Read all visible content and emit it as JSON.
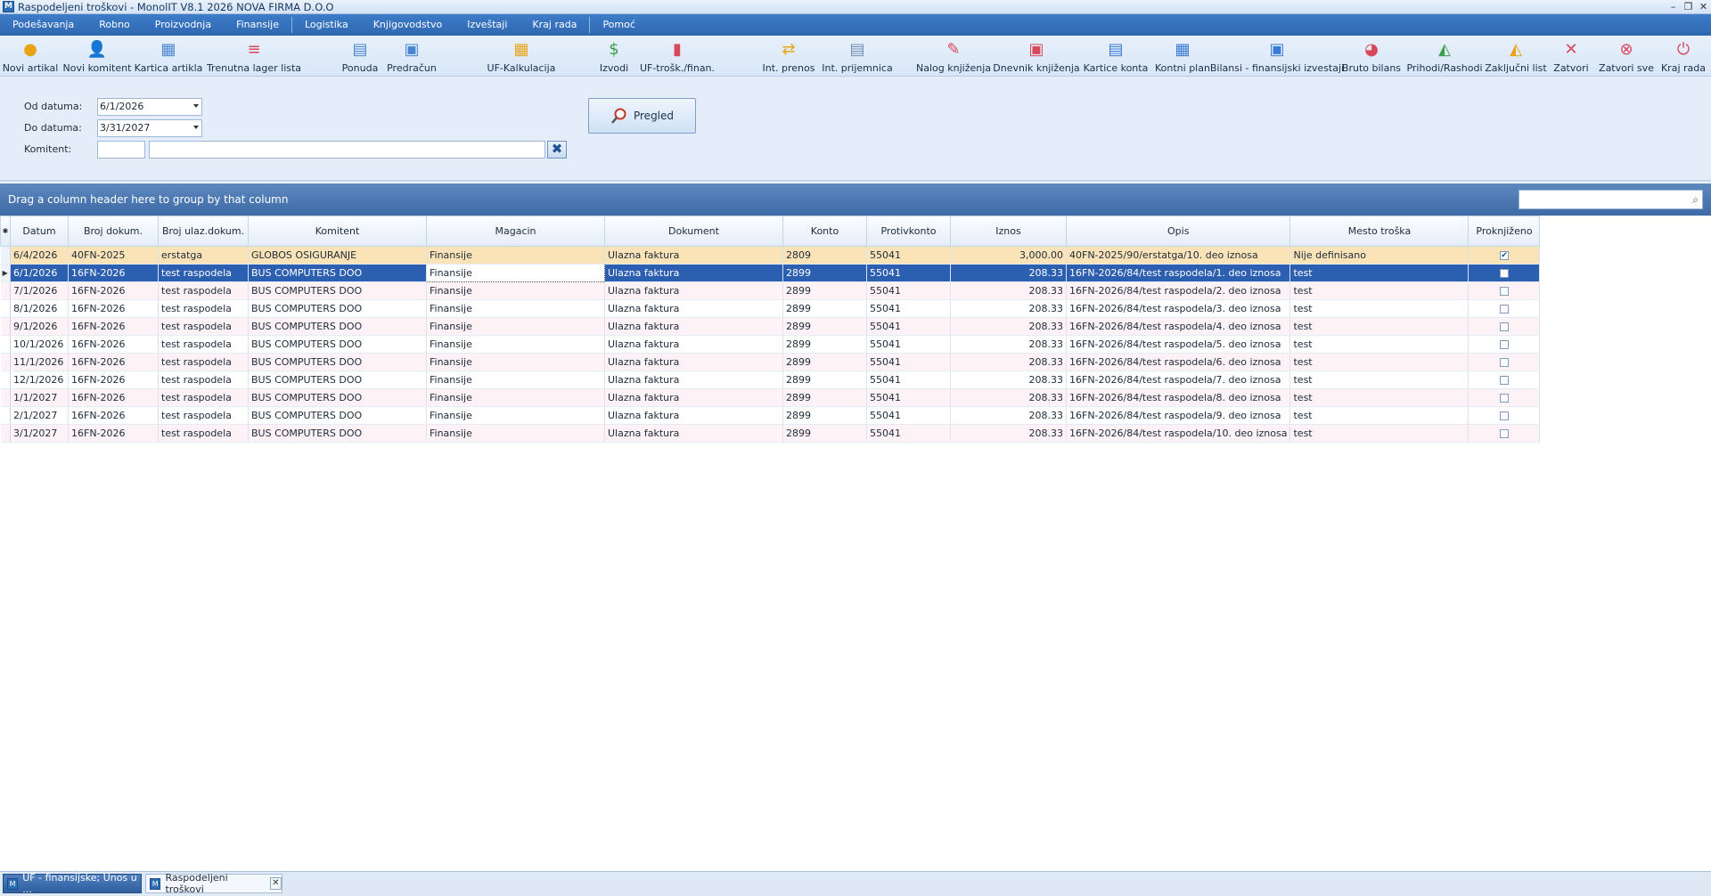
{
  "window": {
    "title": "Raspodeljeni troškovi - MonolIT V8.1 2026 NOVA FIRMA D.O.O",
    "app_icon": "M",
    "minimize": "–",
    "restore": "❐",
    "close": "✕"
  },
  "menu": [
    "Podešavanja",
    "Robno",
    "Proizvodnja",
    "Finansije",
    "Logistika",
    "Knjigovodstvo",
    "Izveštaji",
    "Kraj rada",
    "Pomoć"
  ],
  "toolbar": [
    {
      "label": "Novi artikal",
      "icon": "new-item-icon",
      "glyph": "●",
      "color": "#e8a417"
    },
    {
      "label": "Novi komitent",
      "icon": "new-partner-icon",
      "glyph": "👤",
      "color": "#3a7bd5"
    },
    {
      "label": "Kartica artikla",
      "icon": "item-card-icon",
      "glyph": "▦",
      "color": "#4a86cf"
    },
    {
      "label": "Trenutna lager lista",
      "icon": "stock-list-icon",
      "glyph": "≡",
      "color": "#d9475a"
    },
    {
      "label": "Ponuda",
      "icon": "offer-icon",
      "glyph": "▤",
      "color": "#4a86cf"
    },
    {
      "label": "Predračun",
      "icon": "proforma-icon",
      "glyph": "▣",
      "color": "#4a86cf"
    },
    {
      "label": "UF-Kalkulacija",
      "icon": "calculation-icon",
      "glyph": "▦",
      "color": "#e8a417"
    },
    {
      "label": "Izvodi",
      "icon": "statements-icon",
      "glyph": "$",
      "color": "#3aa04a"
    },
    {
      "label": "UF-trošk./finan.",
      "icon": "expense-icon",
      "glyph": "▮",
      "color": "#d9475a"
    },
    {
      "label": "Int. prenos",
      "icon": "internal-transfer-icon",
      "glyph": "⇄",
      "color": "#e8a417"
    },
    {
      "label": "Int. prijemnica",
      "icon": "internal-receipt-icon",
      "glyph": "▤",
      "color": "#6f8fb8"
    },
    {
      "label": "Nalog knjiženja",
      "icon": "posting-order-icon",
      "glyph": "✎",
      "color": "#d9475a"
    },
    {
      "label": "Dnevnik knjiženja",
      "icon": "posting-journal-icon",
      "glyph": "▣",
      "color": "#d9475a"
    },
    {
      "label": "Kartice konta",
      "icon": "account-cards-icon",
      "glyph": "▤",
      "color": "#3a7bd5"
    },
    {
      "label": "Kontni plan",
      "icon": "chart-of-accounts-icon",
      "glyph": "▦",
      "color": "#3a7bd5"
    },
    {
      "label": "Bilansi - finansijski izvestaji",
      "icon": "financial-reports-icon",
      "glyph": "▣",
      "color": "#3a7bd5"
    },
    {
      "label": "Bruto bilans",
      "icon": "gross-balance-icon",
      "glyph": "◕",
      "color": "#d9475a"
    },
    {
      "label": "Prihodi/Rashodi",
      "icon": "income-expense-icon",
      "glyph": "◭",
      "color": "#3aa04a"
    },
    {
      "label": "Zaključni list",
      "icon": "closing-sheet-icon",
      "glyph": "◭",
      "color": "#e8a417"
    },
    {
      "label": "Zatvori",
      "icon": "close-icon",
      "glyph": "✕",
      "color": "#d9475a"
    },
    {
      "label": "Zatvori sve",
      "icon": "close-all-icon",
      "glyph": "⊗",
      "color": "#d9475a"
    },
    {
      "label": "Kraj rada",
      "icon": "power-icon",
      "glyph": "⏻",
      "color": "#d9475a"
    }
  ],
  "filter": {
    "from_label": "Od datuma:",
    "from_value": "6/1/2026",
    "to_label": "Do datuma:",
    "to_value": "3/31/2027",
    "partner_label": "Komitent:",
    "partner_code": "",
    "partner_name": "",
    "clear_glyph": "✖",
    "preview_label": "Pregled"
  },
  "grid": {
    "group_hint": "Drag a column header here to group by that column",
    "search_glyph": "⌕",
    "columns": [
      "Datum",
      "Broj dokum.",
      "Broj ulaz.dokum.",
      "Komitent",
      "Magacin",
      "Dokument",
      "Konto",
      "Protivkonto",
      "Iznos",
      "Opis",
      "Mesto troška",
      "Proknjiženo"
    ],
    "rows": [
      [
        "6/4/2026",
        "40FN-2025",
        "erstatga",
        "GLOBOS OSIGURANJE",
        "Finansije",
        "Ulazna faktura",
        "2809",
        "55041",
        "3,000.00",
        "40FN-2025/90/erstatga/10. deo iznosa",
        "Nije definisano",
        true
      ],
      [
        "6/1/2026",
        "16FN-2026",
        "test raspodela",
        "BUS COMPUTERS DOO",
        "Finansije",
        "Ulazna faktura",
        "2899",
        "55041",
        "208.33",
        "16FN-2026/84/test raspodela/1. deo iznosa",
        "test",
        false
      ],
      [
        "7/1/2026",
        "16FN-2026",
        "test raspodela",
        "BUS COMPUTERS DOO",
        "Finansije",
        "Ulazna faktura",
        "2899",
        "55041",
        "208.33",
        "16FN-2026/84/test raspodela/2. deo iznosa",
        "test",
        false
      ],
      [
        "8/1/2026",
        "16FN-2026",
        "test raspodela",
        "BUS COMPUTERS DOO",
        "Finansije",
        "Ulazna faktura",
        "2899",
        "55041",
        "208.33",
        "16FN-2026/84/test raspodela/3. deo iznosa",
        "test",
        false
      ],
      [
        "9/1/2026",
        "16FN-2026",
        "test raspodela",
        "BUS COMPUTERS DOO",
        "Finansije",
        "Ulazna faktura",
        "2899",
        "55041",
        "208.33",
        "16FN-2026/84/test raspodela/4. deo iznosa",
        "test",
        false
      ],
      [
        "10/1/2026",
        "16FN-2026",
        "test raspodela",
        "BUS COMPUTERS DOO",
        "Finansije",
        "Ulazna faktura",
        "2899",
        "55041",
        "208.33",
        "16FN-2026/84/test raspodela/5. deo iznosa",
        "test",
        false
      ],
      [
        "11/1/2026",
        "16FN-2026",
        "test raspodela",
        "BUS COMPUTERS DOO",
        "Finansije",
        "Ulazna faktura",
        "2899",
        "55041",
        "208.33",
        "16FN-2026/84/test raspodela/6. deo iznosa",
        "test",
        false
      ],
      [
        "12/1/2026",
        "16FN-2026",
        "test raspodela",
        "BUS COMPUTERS DOO",
        "Finansije",
        "Ulazna faktura",
        "2899",
        "55041",
        "208.33",
        "16FN-2026/84/test raspodela/7. deo iznosa",
        "test",
        false
      ],
      [
        "1/1/2027",
        "16FN-2026",
        "test raspodela",
        "BUS COMPUTERS DOO",
        "Finansije",
        "Ulazna faktura",
        "2899",
        "55041",
        "208.33",
        "16FN-2026/84/test raspodela/8. deo iznosa",
        "test",
        false
      ],
      [
        "2/1/2027",
        "16FN-2026",
        "test raspodela",
        "BUS COMPUTERS DOO",
        "Finansije",
        "Ulazna faktura",
        "2899",
        "55041",
        "208.33",
        "16FN-2026/84/test raspodela/9. deo iznosa",
        "test",
        false
      ],
      [
        "3/1/2027",
        "16FN-2026",
        "test raspodela",
        "BUS COMPUTERS DOO",
        "Finansije",
        "Ulazna faktura",
        "2899",
        "55041",
        "208.33",
        "16FN-2026/84/test raspodela/10. deo iznosa",
        "test",
        false
      ]
    ]
  },
  "tabs": [
    {
      "label": "UF - finansijske; Unos u ...",
      "active": false
    },
    {
      "label": "Raspodeljeni troškovi",
      "active": true,
      "close": "✕"
    }
  ]
}
